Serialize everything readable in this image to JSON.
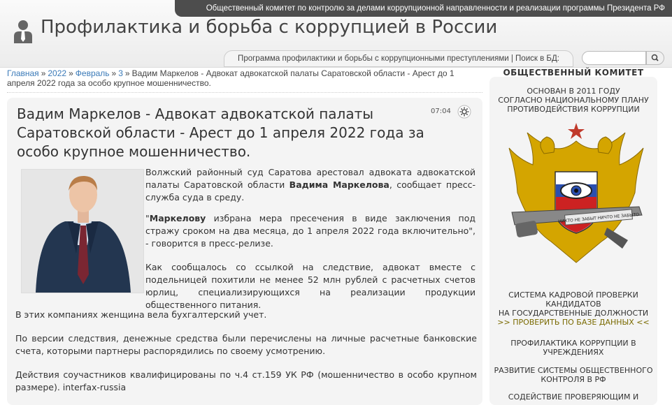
{
  "topbar": {
    "text": "Общественный комитет по контролю за делами коррупционной направленности и реализации программы Президента РФ"
  },
  "header": {
    "title": "Профилактика и борьба с коррупцией в России",
    "subnav": "Программа профилактики и борьбы с коррупционными преступлениями | Поиск в БД:",
    "search_placeholder": ""
  },
  "icons": {
    "logo": "person-tie-icon",
    "search": "search-icon",
    "settings": "gear-icon"
  },
  "breadcrumb": {
    "items": [
      "Главная",
      "2022",
      "Февраль",
      "3"
    ],
    "sep": "»",
    "current": "Вадим Маркелов - Адвокат адвокатской палаты Саратовской области - Арест до 1 апреля 2022 года за особо крупное мошенничество."
  },
  "article": {
    "title": "Вадим Маркелов - Адвокат адвокатской палаты Саратовской области - Арест до 1 апреля 2022 года за особо крупное мошенничество.",
    "time": "07:04",
    "p1_a": "Волжский районный суд Саратова арестовал адвоката адвокатской палаты Саратовской области ",
    "p1_b": "Вадима Маркелова",
    "p1_c": ", сообщает пресс-служба суда в среду.",
    "p2_a": "\"",
    "p2_b": "Маркелову",
    "p2_c": " избрана мера пресечения в виде заключения под стражу сроком на два месяца, до 1 апреля 2022 года включительно\", - говорится в пресс-релизе.",
    "p3": "Как сообщалось со ссылкой на следствие, адвокат вместе с подельницей похитили не менее 52 млн рублей с расчетных счетов юрлиц, специализирующихся на реализации продукции общественного питания.",
    "p4": "В этих компаниях женщина вела бухгалтерский учет.",
    "p5": "По версии следствия, денежные средства были перечислены на личные расчетные банковские счета, которыми партнеры распорядились по своему усмотрению.",
    "p6": "Действия соучастников квалифицированы по ч.4 ст.159 УК РФ (мошенничество в особо крупном размере).  interfax-russia"
  },
  "sidebar": {
    "heading": "ОБЩЕСТВЕННЫЙ КОМИТЕТ",
    "founded_1": "ОСНОВАН В 2011 ГОДУ",
    "founded_2": "СОГЛАСНО НАЦИОНАЛЬНОМУ ПЛАНУ",
    "founded_3": "ПРОТИВОДЕЙСТВИЯ КОРРУПЦИИ",
    "emblem_ribbon": "НИКТО НЕ ЗАБЫТ НИЧТО НЕ ЗАБЫТО",
    "block1_1": "СИСТЕМА КАДРОВОЙ ПРОВЕРКИ",
    "block1_2": "КАНДИДАТОВ",
    "block1_3": "НА ГОСУДАРСТВЕННЫЕ ДОЛЖНОСТИ",
    "block1_link": ">> ПРОВЕРИТЬ ПО БАЗЕ ДАННЫХ <<",
    "block2": "ПРОФИЛАКТИКА КОРРУПЦИИ В УЧРЕЖДЕНИЯХ",
    "block3": "РАЗВИТИЕ СИСТЕМЫ ОБЩЕСТВЕННОГО КОНТРОЛЯ В РФ",
    "block4": "СОДЕЙСТВИЕ ПРОВЕРЯЮЩИМ И"
  }
}
